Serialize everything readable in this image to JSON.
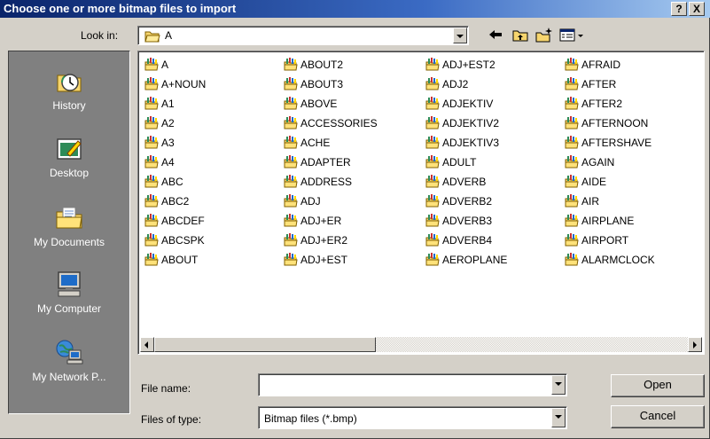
{
  "window": {
    "title": "Choose one or more bitmap files to import",
    "help_label": "?",
    "close_label": "X"
  },
  "look_in": {
    "label": "Look in:",
    "value": "A"
  },
  "places": [
    {
      "label": "History",
      "icon": "history-icon"
    },
    {
      "label": "Desktop",
      "icon": "desktop-icon"
    },
    {
      "label": "My Documents",
      "icon": "my-documents-icon"
    },
    {
      "label": "My Computer",
      "icon": "my-computer-icon"
    },
    {
      "label": "My Network P...",
      "icon": "my-network-places-icon"
    }
  ],
  "files": {
    "columns": [
      [
        "A",
        "A+NOUN",
        "A1",
        "A2",
        "A3",
        "A4",
        "ABC",
        "ABC2",
        "ABCDEF",
        "ABCSPK",
        "ABOUT"
      ],
      [
        "ABOUT2",
        "ABOUT3",
        "ABOVE",
        "ACCESSORIES",
        "ACHE",
        "ADAPTER",
        "ADDRESS",
        "ADJ",
        "ADJ+ER",
        "ADJ+ER2",
        "ADJ+EST"
      ],
      [
        "ADJ+EST2",
        "ADJ2",
        "ADJEKTIV",
        "ADJEKTIV2",
        "ADJEKTIV3",
        "ADULT",
        "ADVERB",
        "ADVERB2",
        "ADVERB3",
        "ADVERB4",
        "AEROPLANE"
      ],
      [
        "AFRAID",
        "AFTER",
        "AFTER2",
        "AFTERNOON",
        "AFTERSHAVE",
        "AGAIN",
        "AIDE",
        "AIR",
        "AIRPLANE",
        "AIRPORT",
        "ALARMCLOCK"
      ]
    ],
    "item_icon": "folder-shortcut-icon"
  },
  "file_name": {
    "label": "File name:",
    "value": ""
  },
  "file_type": {
    "label": "Files of type:",
    "value": "Bitmap files (*.bmp)"
  },
  "buttons": {
    "open": "Open",
    "cancel": "Cancel"
  },
  "colors": {
    "title_bar_start": "#0a246a",
    "title_bar_end": "#a6caf0",
    "dialog_face": "#d4d0c8",
    "places_bar": "#808080"
  }
}
